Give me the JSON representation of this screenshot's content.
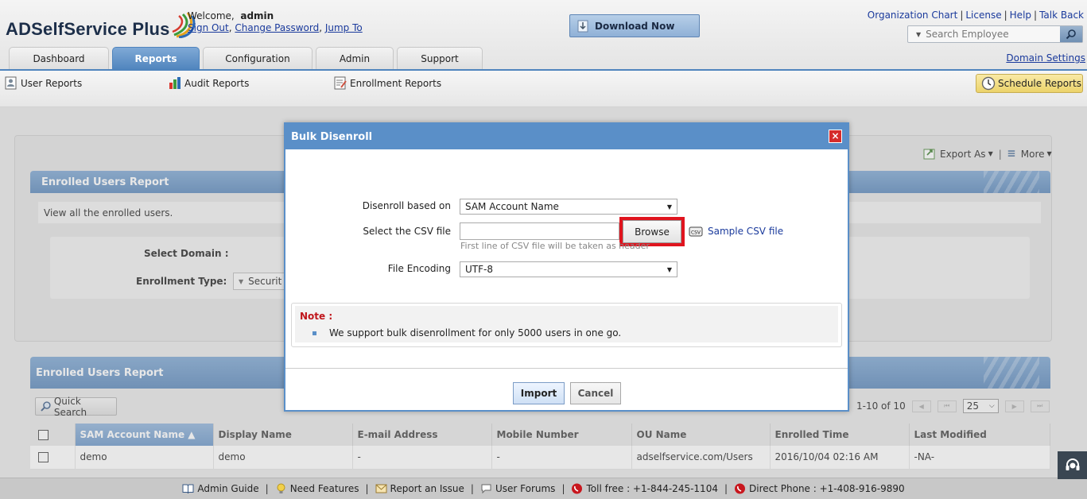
{
  "header": {
    "logo_text": "ADSelfService Plus",
    "welcome": "Welcome,",
    "username": "admin",
    "sign_out": "Sign Out",
    "change_password": "Change Password",
    "jump_to": "Jump To",
    "download_label": "Download Now",
    "top_links": [
      "Organization Chart",
      "License",
      "Help",
      "Talk Back"
    ],
    "search_placeholder": "Search Employee",
    "domain_settings": "Domain Settings"
  },
  "tabs": [
    {
      "label": "Dashboard",
      "active": false
    },
    {
      "label": "Reports",
      "active": true
    },
    {
      "label": "Configuration",
      "active": false
    },
    {
      "label": "Admin",
      "active": false
    },
    {
      "label": "Support",
      "active": false
    }
  ],
  "subnav": {
    "user_reports": "User Reports",
    "audit_reports": "Audit Reports",
    "enrollment_reports": "Enrollment Reports",
    "schedule_reports": "Schedule Reports"
  },
  "main": {
    "export_as": "Export As",
    "more": "More",
    "panel_title": "Enrolled Users Report",
    "description": "View all the enrolled users.",
    "select_domain_label": "Select Domain :",
    "enrollment_type_label": "Enrollment Type:",
    "enrollment_type_value": "Securit",
    "report_title": "Enrolled Users Report",
    "quick_search": "Quick Search",
    "pager_text": "1-10 of 10",
    "page_size": "25",
    "columns": [
      "SAM Account Name",
      "Display Name",
      "E-mail Address",
      "Mobile Number",
      "OU Name",
      "Enrolled Time",
      "Last Modified"
    ],
    "rows": [
      [
        "demo",
        "demo",
        "-",
        "-",
        "adselfservice.com/Users",
        "2016/10/04 02:16 AM",
        "-NA-"
      ]
    ]
  },
  "modal": {
    "title": "Bulk Disenroll",
    "close_label": "×",
    "disenroll_label": "Disenroll based on",
    "disenroll_value": "SAM Account Name",
    "csv_label": "Select the CSV file",
    "browse_label": "Browse",
    "sample_csv": "Sample CSV file",
    "hint": "First line of CSV file will be taken as header",
    "encoding_label": "File Encoding",
    "encoding_value": "UTF-8",
    "note_title": "Note :",
    "note_text": "We support bulk disenrollment for only 5000 users in one go.",
    "import_label": "Import",
    "cancel_label": "Cancel"
  },
  "footer": {
    "items": [
      "Admin Guide",
      "Need Features",
      "Report an Issue",
      "User Forums",
      "Toll free : +1-844-245-1104",
      "Direct Phone : +1-408-916-9890"
    ]
  },
  "colors": {
    "accent_blue": "#5a8fc8",
    "highlight_red": "#e0141e",
    "note_red": "#c0161c"
  }
}
